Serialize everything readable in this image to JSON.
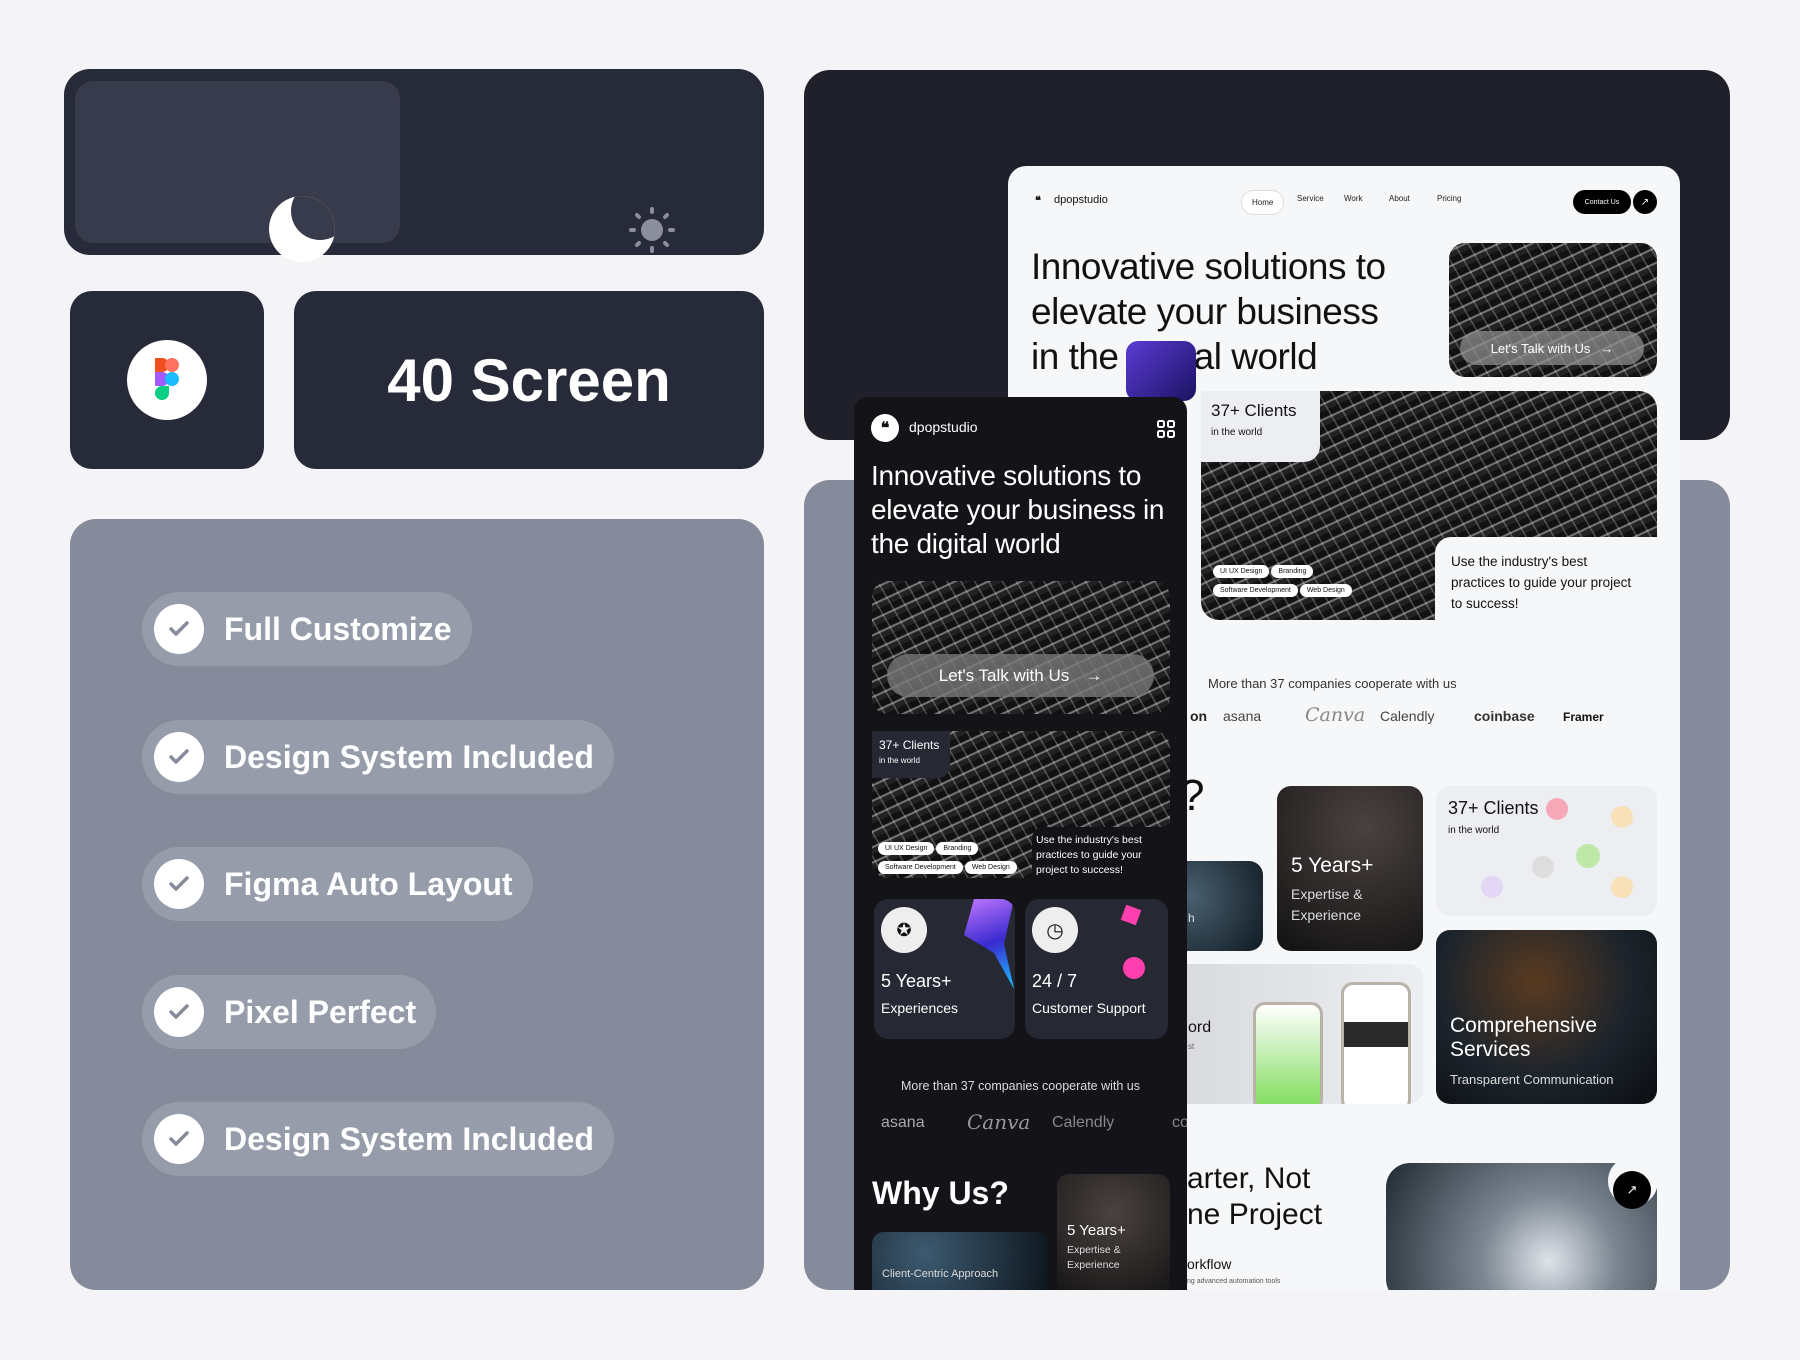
{
  "theme_toggle": {
    "options": [
      {
        "icon": "moon-icon",
        "selected": true
      },
      {
        "icon": "sun-icon",
        "selected": false
      }
    ]
  },
  "figma": {
    "icon": "figma-icon"
  },
  "screens": {
    "label": "40 Screen"
  },
  "features": [
    "Full Customize",
    "Design System Included",
    "Figma Auto Layout",
    "Pixel Perfect",
    "Design System Included"
  ],
  "desktop": {
    "brand": "dpopstudio",
    "nav": [
      "Home",
      "Service",
      "Work",
      "About",
      "Pricing"
    ],
    "contact": "Contact Us",
    "headline": "Innovative solutions to elevate your business in the digital world",
    "cta": "Let's Talk with Us",
    "clients": {
      "title": "37+ Clients",
      "sub": "in the world"
    },
    "tags": [
      "UI UX Design",
      "Branding",
      "Software Development",
      "Web Design"
    ],
    "practices": "Use the industry's best practices to guide your project to success!",
    "companies_text": "More than 37 companies cooperate with us",
    "logos": [
      "on",
      "asana",
      "Canva",
      "Calendly",
      "coinbase",
      "Framer"
    ],
    "why_partial": "?",
    "years": {
      "title": "5 Years+",
      "sub": "Expertise & Experience"
    },
    "left_partial": "h",
    "word_partial": "ord",
    "word_partial_sub": "st",
    "services": {
      "title": "Comprehensive Services",
      "sub": "Transparent Communication"
    },
    "smarter": "arter, Not\nne Project",
    "workflow": "orkflow",
    "workflow_sub": "ng advanced automation tools"
  },
  "mobile": {
    "brand": "dpopstudio",
    "headline": "Innovative solutions to elevate your business in the digital world",
    "cta": "Let's Talk with Us",
    "clients": {
      "title": "37+ Clients",
      "sub": "in the world"
    },
    "tags": [
      "UI UX Design",
      "Branding",
      "Software Development",
      "Web Design"
    ],
    "practices": "Use the industry's best practices to guide your project to success!",
    "stats": [
      {
        "value": "5 Years+",
        "label": "Experiences",
        "icon": "badge-check-icon"
      },
      {
        "value": "24 / 7",
        "label": "Customer Support",
        "icon": "clock-icon"
      }
    ],
    "companies_text": "More than 37 companies cooperate with us",
    "logos": [
      "asana",
      "Canva",
      "Calendly",
      "co"
    ],
    "why": "Why Us?",
    "approach": "Client-Centric Approach",
    "years": {
      "title": "5 Years+",
      "sub": "Expertise & Experience"
    }
  }
}
